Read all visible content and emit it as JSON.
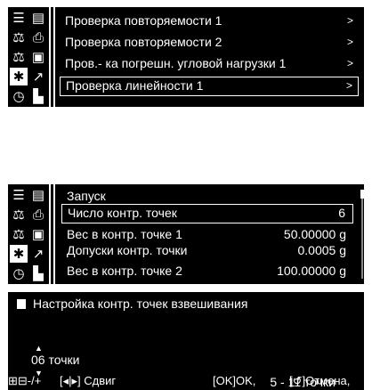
{
  "panel1": {
    "menu": [
      {
        "label": "Проверка повторяемости 1",
        "chevron": ">"
      },
      {
        "label": "Проверка повторяемости  2",
        "chevron": ">"
      },
      {
        "label": "Пров.- ка погрешн. угловой нагрузки 1",
        "chevron": ">"
      },
      {
        "label": "Проверка линейности 1",
        "chevron": ">"
      }
    ]
  },
  "panel2": {
    "rows": [
      {
        "label": "Запуск",
        "value": ""
      },
      {
        "label": "Число контр. точек",
        "value": "6"
      },
      {
        "label": "Вес в контр. точке 1",
        "value": "50.00000 g"
      },
      {
        "label": "Допуски контр. точки",
        "value": "0.0005 g"
      },
      {
        "label": "Вес в контр. точке 2",
        "value": "100.00000 g"
      }
    ]
  },
  "panel3": {
    "title": "Настройка контр. точек взвешивания",
    "value": "06 точки",
    "range": "5 - 11 точки",
    "footer": {
      "change": "-/+",
      "shift_key": "[◂|▸]",
      "shift": "Сдвиг",
      "ok_key": "[OK]",
      "ok": "OK,",
      "cancel_key": "[↺]",
      "cancel": "Отмена,"
    }
  },
  "icons": [
    "list-icon",
    "calendar-icon",
    "balance-icon",
    "print-icon",
    "balance-star-icon",
    "save-icon",
    "gear-icon",
    "chart-icon",
    "clock-icon",
    "weight-icon"
  ]
}
